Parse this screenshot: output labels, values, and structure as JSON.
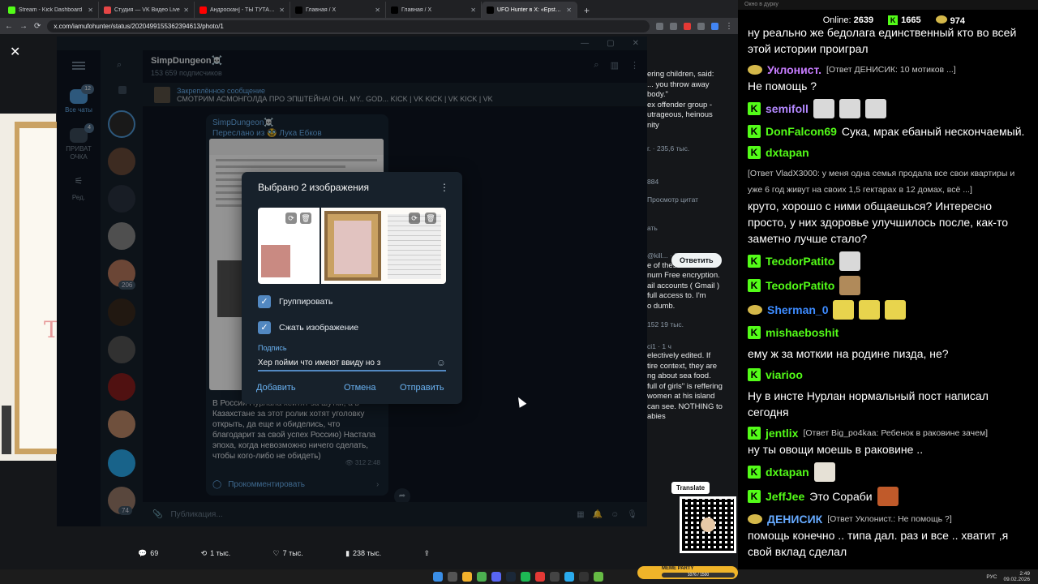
{
  "browser": {
    "tabs": [
      {
        "title": "Stream - Kick Dashboard",
        "color": "#53fc18",
        "active": false
      },
      {
        "title": "Студия — VK Видео Live",
        "color": "#e64646",
        "active": false
      },
      {
        "title": "Андроскан] - ТЫ ТУТА... И Я ТУТ",
        "color": "#ff0000",
        "active": false
      },
      {
        "title": "Главная / X",
        "color": "#000000",
        "active": false
      },
      {
        "title": "Главная / X",
        "color": "#000000",
        "active": false
      },
      {
        "title": "UFO Hunter в X: «Epstein, whi...",
        "color": "#000000",
        "active": true
      }
    ],
    "new_tab": "+",
    "url": "x.com/iamufohunter/status/2020499155362394613/photo/1"
  },
  "xpage": {
    "close": "✕",
    "tweet_lines": [
      "ering children, said:",
      "... you throw away",
      "body.\"",
      "",
      "ex offender group -",
      "utrageous, heinous",
      "nity"
    ],
    "stats1": "г. · 235,6 тыс.",
    "stats2": "ать",
    "views": "884",
    "promote": "Просмотр цитат",
    "reply_btn": "Ответить",
    "reply_user": "@kill... · 8 ч",
    "reply_lines": [
      "e of these idiots are",
      "num Free encryption.",
      "ail accounts ( Gmail )",
      "full access to. I'm",
      "o dumb."
    ],
    "reply_stats": "152    19 тыс.",
    "reply2_user": "ci1 · 1 ч",
    "reply2_lines": [
      "electively edited. If",
      "tire context, they are",
      "ng about sea food.",
      "full of girls\" is reffering",
      "women at his island",
      "can see. NOTHING to",
      "abies"
    ],
    "translate": "Translate",
    "bottom": {
      "replies": "69",
      "reposts": "1 тыс.",
      "likes": "7 тыс.",
      "views": "238 тыс."
    }
  },
  "telegram": {
    "folders": [
      {
        "label": "Все чаты",
        "badge": "12"
      },
      {
        "label": "ПРИВАТ ОЧКА",
        "badge": "4"
      },
      {
        "label": "Ред.",
        "badge": ""
      }
    ],
    "avatar_badges": [
      "206",
      "74"
    ],
    "channel": {
      "title": "SimpDungeon☠️",
      "subscribers": "153 659 подписчиков"
    },
    "pinned": {
      "label": "Закреплённое сообщение",
      "text": "СМОТРИМ АСМОНГОЛДА ПРО ЭПШТЕЙНА! OH.. MY.. GOD... KICK | VK KICK | VK KICK | VK"
    },
    "message": {
      "from": "SimpDungeon☠️",
      "forwarded": "Переслано из 🥸 Лука Ебков",
      "text": "В России Нурлана хейтят за шутки, а в Казахстане за этот ролик хотят уголовку открыть, да еще и обиделись, что благодарит за свой успех Россию) Настала эпоха, когда невозможно ничего сделать, чтобы кого-либо не обидеть)",
      "views": "312",
      "time": "2:48",
      "comment": "Прокомментировать"
    },
    "compose_placeholder": "Публикация..."
  },
  "dialog": {
    "title": "Выбрано 2 изображения",
    "options": [
      {
        "label": "Группировать",
        "checked": true
      },
      {
        "label": "Сжать изображение",
        "checked": true
      }
    ],
    "caption_label": "Подпись",
    "caption_value": "Хер пойми что имеют ввиду но з",
    "add": "Добавить",
    "cancel": "Отмена",
    "send": "Отправить"
  },
  "kick": {
    "window_title": "Окно в дурку",
    "online_label": "Online:",
    "online": "2639",
    "followers": "1665",
    "subs": "974",
    "messages": [
      {
        "user": "",
        "color": "#ffffff",
        "badge": "",
        "text": "ну реально же бедолага единственный кто во всей этой истории проиграл",
        "reply": ""
      },
      {
        "user": "Уклонист.",
        "color": "#c77dff",
        "badge": "sub",
        "text": "Не помощь ?",
        "reply": "[Ответ ДЕНИСИК: 10 мотиков ...]"
      },
      {
        "user": "semifoll",
        "color": "#b388ff",
        "badge": "kick",
        "text": "",
        "reply": "",
        "emotes": [
          "#d9d9d9",
          "#d9d9d9",
          "#d9d9d9"
        ]
      },
      {
        "user": "DonFalcon69",
        "color": "#53fc18",
        "badge": "kick",
        "text": "Сука, мрак ебаный нескончаемый.",
        "reply": ""
      },
      {
        "user": "dxtapan",
        "color": "#53fc18",
        "badge": "kick",
        "text": "круто, хорошо с ними общаешься? Интересно просто, у них здоровье улучшилось после, как-то заметно лучше стало?",
        "reply": "[Ответ VladX3000: у меня одна семья продала все свои квартиры и уже 6 год живут на своих 1,5 гектарах в 12 домах, всё ...]"
      },
      {
        "user": "TeodorPatito",
        "color": "#53fc18",
        "badge": "kick",
        "text": "",
        "reply": "",
        "emotes": [
          "#d9d9d9"
        ]
      },
      {
        "user": "TeodorPatito",
        "color": "#53fc18",
        "badge": "kick",
        "text": "",
        "reply": "",
        "emotes": [
          "#b08a5a"
        ]
      },
      {
        "user": "Sherman_0",
        "color": "#3d8bff",
        "badge": "sub",
        "text": "",
        "reply": "",
        "emotes": [
          "#e8d44d",
          "#e8d44d",
          "#e8d44d"
        ]
      },
      {
        "user": "mishaeboshit",
        "color": "#53fc18",
        "badge": "kick",
        "text": "ему ж за моткии на родине пизда, не?",
        "reply": ""
      },
      {
        "user": "viarioo",
        "color": "#53fc18",
        "badge": "kick",
        "text": "Ну в инсте Нурлан нормальный пост написал сегодня",
        "reply": ""
      },
      {
        "user": "jentlix",
        "color": "#53fc18",
        "badge": "kick",
        "text": "ну ты овощи моешь в раковине ..",
        "reply": "[Ответ Big_po4kaa: Ребенок в раковине зачем]"
      },
      {
        "user": "dxtapan",
        "color": "#53fc18",
        "badge": "kick",
        "text": "",
        "reply": "",
        "emotes": [
          "#e6e1d6"
        ]
      },
      {
        "user": "JeffJee",
        "color": "#53fc18",
        "badge": "kick",
        "text": "Это Сораби",
        "reply": "",
        "emotes": [
          "#c05a2a"
        ]
      },
      {
        "user": "ДЕНИСИК",
        "color": "#66aaff",
        "badge": "sub",
        "text": "помощь конечно .. типа дал. раз и все .. хватит ,я свой вклад сделал",
        "reply": "[Ответ Уклонист.: Не помощь ?]"
      }
    ]
  },
  "taskbar": {
    "meme_label": "MEME PARTY",
    "meme_progress": "1076 / 1500",
    "lang": "РУС",
    "time": "2:49",
    "date": "09.02.2026"
  }
}
